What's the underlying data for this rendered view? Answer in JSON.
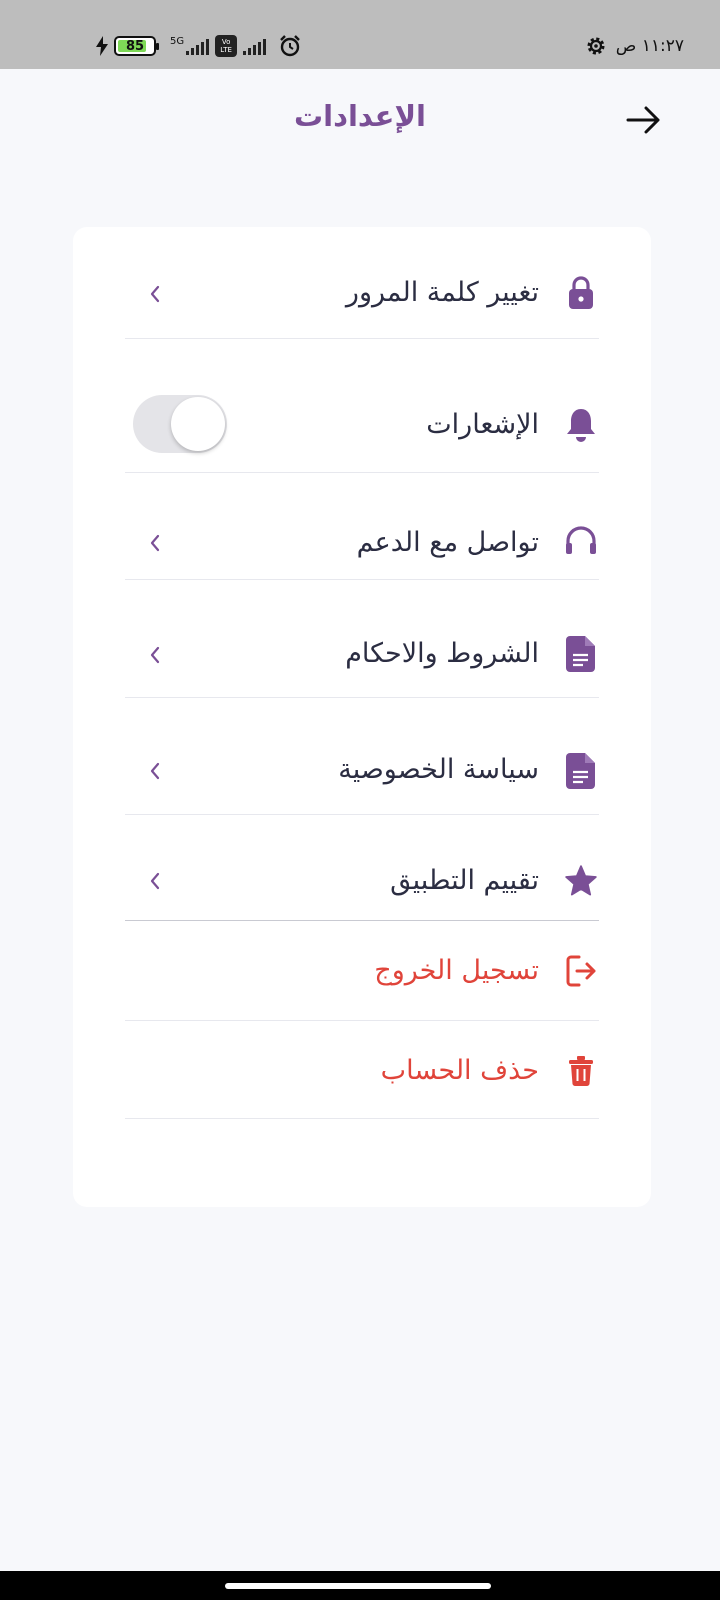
{
  "status_bar": {
    "time": "١١:٢٧ ص",
    "battery_level": "85",
    "network_type": "5G",
    "volte_top": "Vo",
    "volte_bottom": "LTE"
  },
  "header": {
    "title": "الإعدادات",
    "back_icon": "arrow-right-icon"
  },
  "colors": {
    "brand": "#7a4f96",
    "text": "#2b2d42",
    "danger": "#e0443a",
    "background": "#f7f8fb"
  },
  "settings": {
    "change_password": {
      "label": "تغيير كلمة المرور",
      "icon": "lock-icon"
    },
    "notifications": {
      "label": "الإشعارات",
      "icon": "bell-icon",
      "enabled": false
    },
    "support": {
      "label": "تواصل مع الدعم",
      "icon": "headset-icon"
    },
    "terms": {
      "label": "الشروط والاحكام",
      "icon": "document-icon"
    },
    "privacy": {
      "label": "سياسة الخصوصية",
      "icon": "document-icon"
    },
    "rate_app": {
      "label": "تقييم التطبيق",
      "icon": "star-icon"
    },
    "logout": {
      "label": "تسجيل الخروج",
      "icon": "logout-icon"
    },
    "delete_account": {
      "label": "حذف الحساب",
      "icon": "trash-icon"
    }
  }
}
